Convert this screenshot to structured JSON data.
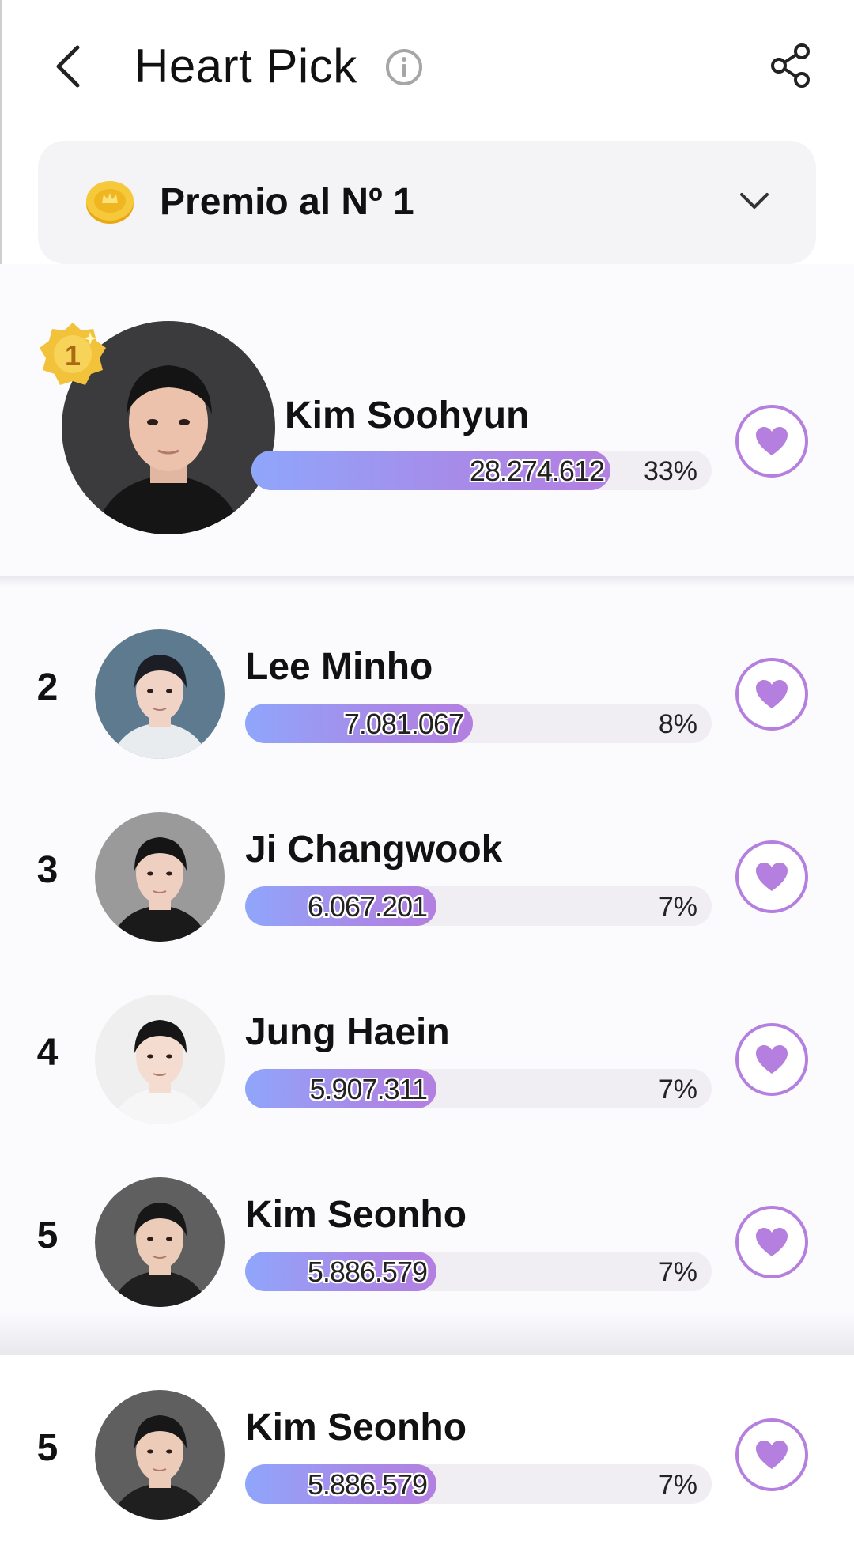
{
  "header": {
    "title": "Heart Pick",
    "icons": {
      "back": "chevron-left-icon",
      "info": "info-icon",
      "share": "share-icon"
    }
  },
  "prize": {
    "label": "Premio al Nº 1",
    "icon": "gold-coin-icon",
    "dropdown_icon": "chevron-down-icon"
  },
  "colors": {
    "accent": "#b47fde",
    "bar_start": "#8fa6fb",
    "bar_end": "#b37fe0",
    "medal": "#f2c33a"
  },
  "entries": [
    {
      "rank": "1",
      "name": "Kim Soohyun",
      "votes": "28.274.612",
      "percent": "33%",
      "share": 0.33
    },
    {
      "rank": "2",
      "name": "Lee Minho",
      "votes": "7.081.067",
      "percent": "8%",
      "share": 0.08
    },
    {
      "rank": "3",
      "name": "Ji Changwook",
      "votes": "6.067.201",
      "percent": "7%",
      "share": 0.07
    },
    {
      "rank": "4",
      "name": "Jung Haein",
      "votes": "5.907.311",
      "percent": "7%",
      "share": 0.07
    },
    {
      "rank": "5",
      "name": "Kim Seonho",
      "votes": "5.886.579",
      "percent": "7%",
      "share": 0.07
    },
    {
      "rank": "5",
      "name": "Kim Seonho",
      "votes": "5.886.579",
      "percent": "7%",
      "share": 0.07
    }
  ]
}
